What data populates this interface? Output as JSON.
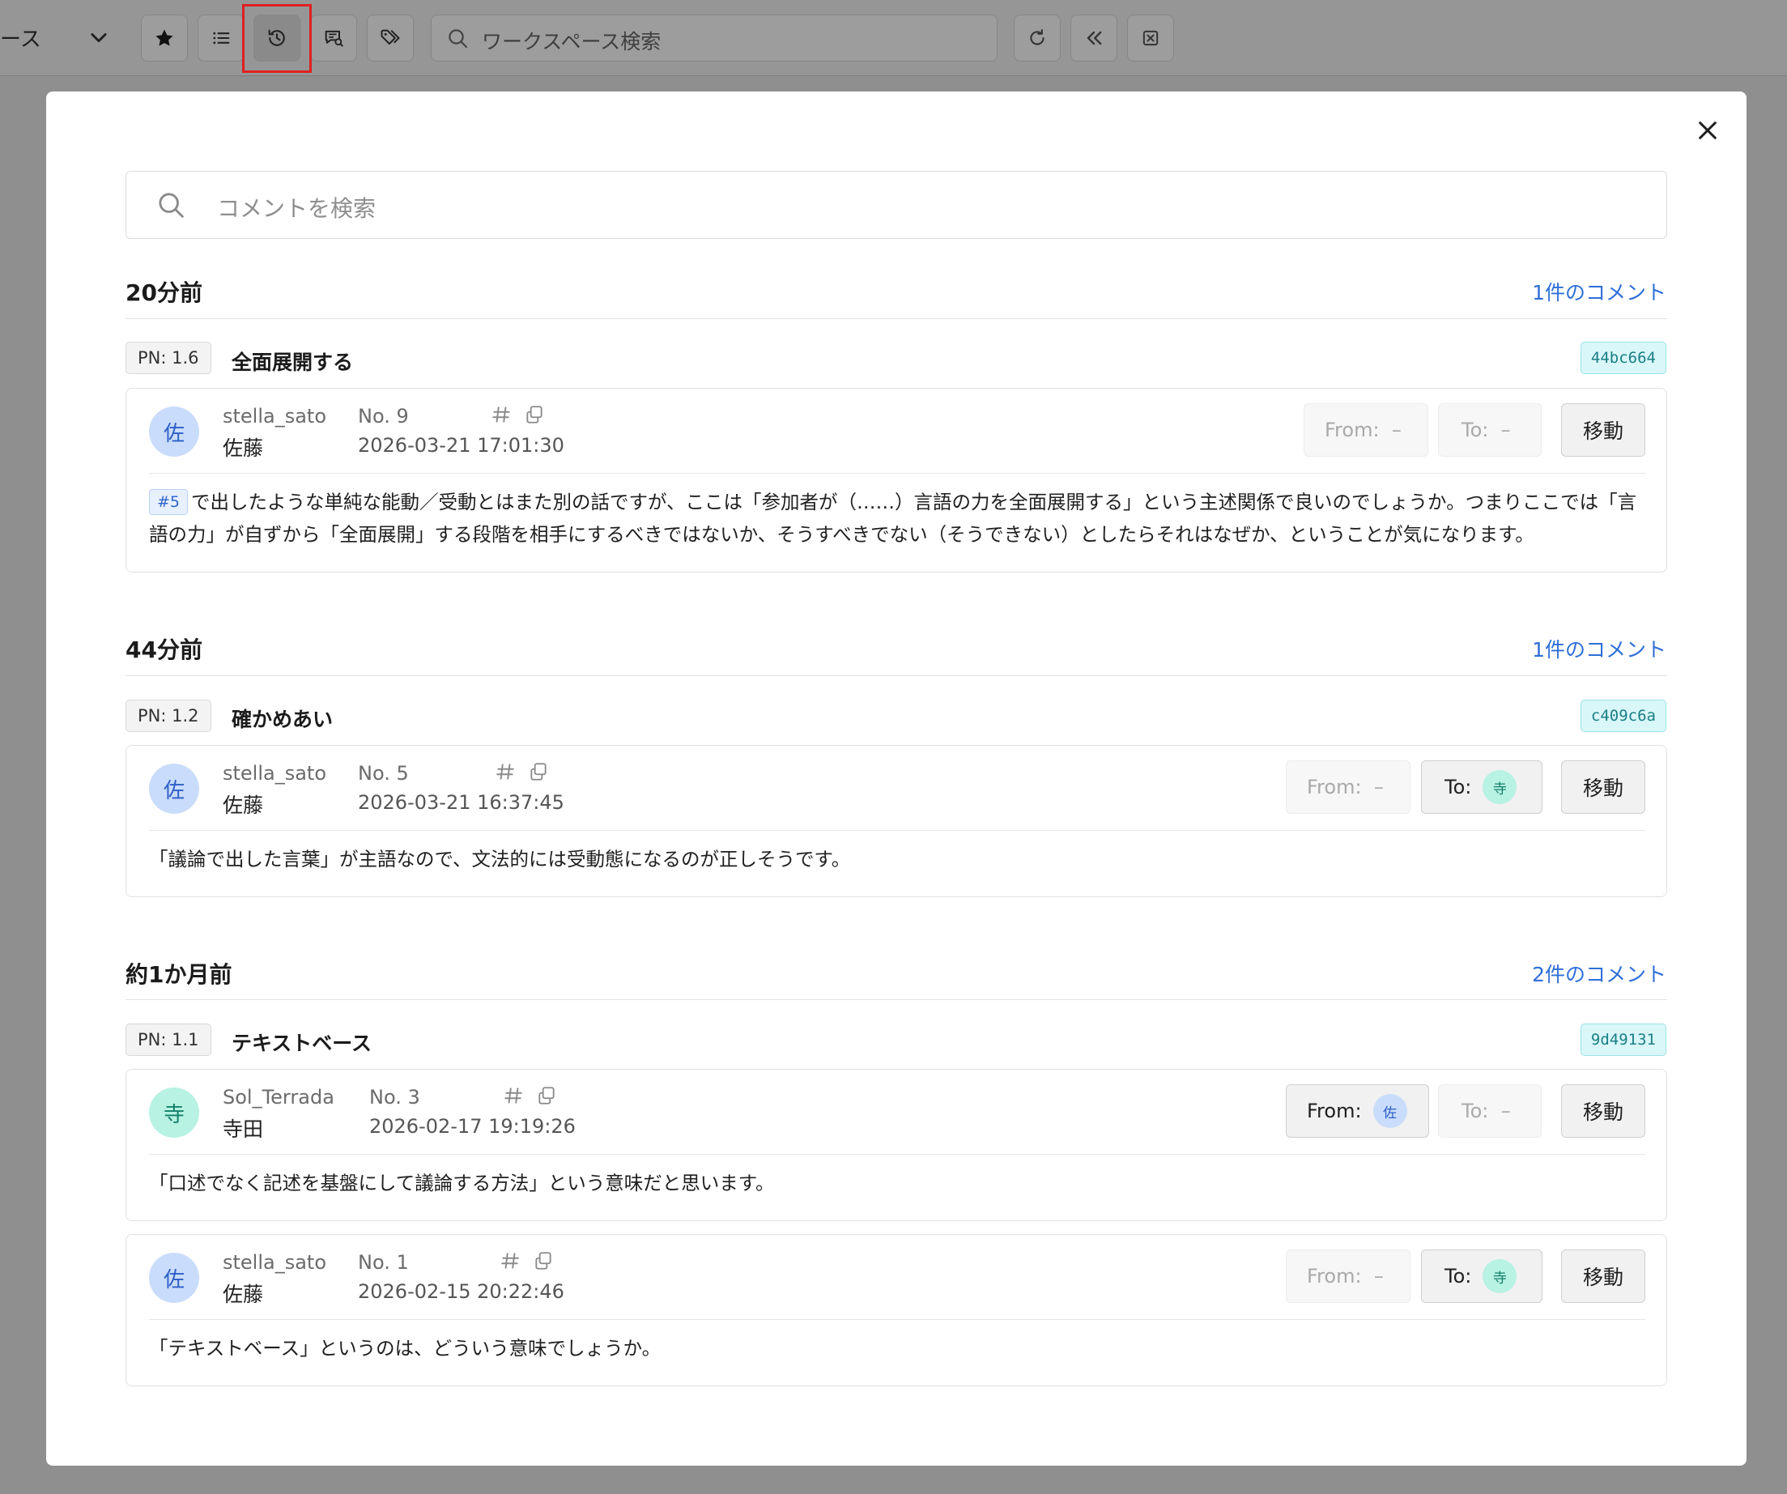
{
  "toolbar": {
    "workspace_label": "ース",
    "search_placeholder": "ワークスペース検索",
    "buttons": [
      "star-icon",
      "list-icon",
      "history-icon",
      "comment-search-icon",
      "tags-icon",
      "refresh-icon",
      "collapse-icon",
      "close-box-icon"
    ],
    "active_button": "history-icon"
  },
  "modal": {
    "search_placeholder": "コメントを検索",
    "move_label": "移動",
    "from_label": "From:",
    "to_label": "To:",
    "empty_mark": "–",
    "hash_mark": "#"
  },
  "groups": [
    {
      "time": "20分前",
      "count_label": "1件のコメント",
      "pn": "PN: 1.6",
      "title": "全面展開する",
      "hash": "44bc664",
      "comments": [
        {
          "username": "stella_sato",
          "realname": "佐藤",
          "avatar": "佐",
          "number": "No. 9",
          "datetime": "2026-03-21 17:01:30",
          "from": null,
          "to": null,
          "ref": "#5",
          "text": "で出したような単純な能動／受動とはまた別の話ですが、ここは「参加者が（……）言語の力を全面展開する」という主述関係で良いのでしょうか。つまりここでは「言語の力」が自ずから「全面展開」する段階を相手にするべきではないか、そうすべきでない（そうできない）としたらそれはなぜか、ということが気になります。"
        }
      ]
    },
    {
      "time": "44分前",
      "count_label": "1件のコメント",
      "pn": "PN: 1.2",
      "title": "確かめあい",
      "hash": "c409c6a",
      "comments": [
        {
          "username": "stella_sato",
          "realname": "佐藤",
          "avatar": "佐",
          "number": "No. 5",
          "datetime": "2026-03-21 16:37:45",
          "from": null,
          "to": "寺",
          "text": "「議論で出した言葉」が主語なので、文法的には受動態になるのが正しそうです。"
        }
      ]
    },
    {
      "time": "約1か月前",
      "count_label": "2件のコメント",
      "pn": "PN: 1.1",
      "title": "テキストベース",
      "hash": "9d49131",
      "comments": [
        {
          "username": "Sol_Terrada",
          "realname": "寺田",
          "avatar": "寺",
          "number": "No. 3",
          "datetime": "2026-02-17 19:19:26",
          "from": "佐",
          "to": null,
          "text": "「口述でなく記述を基盤にして議論する方法」という意味だと思います。"
        },
        {
          "username": "stella_sato",
          "realname": "佐藤",
          "avatar": "佐",
          "number": "No. 1",
          "datetime": "2026-02-15 20:22:46",
          "from": null,
          "to": "寺",
          "text": "「テキストベース」というのは、どういう意味でしょうか。"
        }
      ]
    }
  ],
  "colors": {
    "link_blue": "#2f6fd8",
    "hash_cyan": "#d9f7f9",
    "avatar_sato": "#c9dcfb",
    "avatar_terada": "#b7f2e2",
    "highlight_red": "#e02020"
  }
}
